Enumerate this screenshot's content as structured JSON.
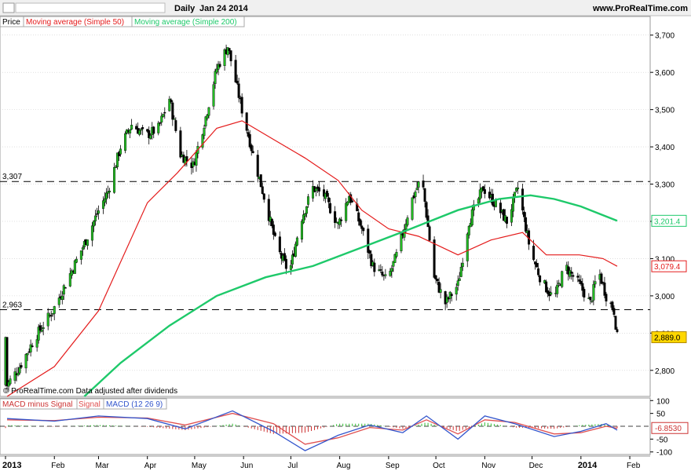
{
  "header": {
    "interval": "Daily",
    "date": "Jan 24 2014",
    "source": "www.ProRealTime.com"
  },
  "legend": {
    "price": "Price",
    "ma50": "Moving average (Simple 50)",
    "ma200": "Moving average (Simple 200)"
  },
  "watermark": "© ProRealTime.com  Data adjusted after dividends",
  "colors": {
    "ma50": "#e41b1b",
    "ma200": "#1ec96a",
    "grid": "#cccccc",
    "last_price_bg": "#ffd700",
    "macd": "#3355cc",
    "signal": "#e05050",
    "hist_pos": "#33bb33",
    "hist_neg": "#cc3333"
  },
  "chart_data": {
    "type": "candlestick",
    "x_axis": {
      "labels": [
        "2013",
        "Feb",
        "Mar",
        "Apr",
        "May",
        "Jun",
        "Jul",
        "Aug",
        "Sep",
        "Oct",
        "Nov",
        "Dec",
        "2014",
        "Feb"
      ],
      "start": "2013-01-01",
      "end": "2014-01-24"
    },
    "y_axis": {
      "ticks": [
        2800,
        2900,
        3000,
        3100,
        3200,
        3300,
        3400,
        3500,
        3600,
        3700
      ],
      "tick_labels": [
        "2,800",
        "2,900",
        "3,000",
        "3,100",
        "3,200",
        "3,300",
        "3,400",
        "3,500",
        "3,600",
        "3,700"
      ],
      "ylim": [
        2730,
        3750
      ]
    },
    "horizontal_lines": [
      {
        "value": 3307,
        "label": "3,307",
        "style": "dashed"
      },
      {
        "value": 2963,
        "label": "2,963",
        "style": "dashed"
      }
    ],
    "last_values": [
      {
        "label": "3,201.4",
        "value": 3201.4,
        "series": "ma200"
      },
      {
        "label": "3,079.4",
        "value": 3079.4,
        "series": "ma50"
      },
      {
        "label": "2,889.0",
        "value": 2889.0,
        "series": "price"
      }
    ],
    "price_path": [
      [
        "2013-01-02",
        2760
      ],
      [
        "2013-01-10",
        2810
      ],
      [
        "2013-01-20",
        2890
      ],
      [
        "2013-01-31",
        2960
      ],
      [
        "2013-02-10",
        3050
      ],
      [
        "2013-02-20",
        3140
      ],
      [
        "2013-02-28",
        3220
      ],
      [
        "2013-03-07",
        3280
      ],
      [
        "2013-03-15",
        3400
      ],
      [
        "2013-03-22",
        3460
      ],
      [
        "2013-03-31",
        3430
      ],
      [
        "2013-04-08",
        3450
      ],
      [
        "2013-04-15",
        3530
      ],
      [
        "2013-04-22",
        3380
      ],
      [
        "2013-04-30",
        3350
      ],
      [
        "2013-05-08",
        3480
      ],
      [
        "2013-05-15",
        3610
      ],
      [
        "2013-05-22",
        3670
      ],
      [
        "2013-05-31",
        3500
      ],
      [
        "2013-06-07",
        3380
      ],
      [
        "2013-06-15",
        3250
      ],
      [
        "2013-06-22",
        3130
      ],
      [
        "2013-06-30",
        3060
      ],
      [
        "2013-07-07",
        3200
      ],
      [
        "2013-07-15",
        3290
      ],
      [
        "2013-07-22",
        3270
      ],
      [
        "2013-07-31",
        3190
      ],
      [
        "2013-08-07",
        3270
      ],
      [
        "2013-08-15",
        3180
      ],
      [
        "2013-08-22",
        3080
      ],
      [
        "2013-08-31",
        3040
      ],
      [
        "2013-09-07",
        3120
      ],
      [
        "2013-09-15",
        3250
      ],
      [
        "2013-09-22",
        3320
      ],
      [
        "2013-09-30",
        3050
      ],
      [
        "2013-10-07",
        2980
      ],
      [
        "2013-10-15",
        3030
      ],
      [
        "2013-10-22",
        3200
      ],
      [
        "2013-10-31",
        3290
      ],
      [
        "2013-11-07",
        3250
      ],
      [
        "2013-11-15",
        3200
      ],
      [
        "2013-11-22",
        3290
      ],
      [
        "2013-11-30",
        3120
      ],
      [
        "2013-12-07",
        3040
      ],
      [
        "2013-12-15",
        2990
      ],
      [
        "2013-12-22",
        3080
      ],
      [
        "2013-12-31",
        3030
      ],
      [
        "2014-01-07",
        2980
      ],
      [
        "2014-01-12",
        3070
      ],
      [
        "2014-01-17",
        3000
      ],
      [
        "2014-01-22",
        2960
      ],
      [
        "2014-01-24",
        2889
      ]
    ],
    "series": [
      {
        "name": "Moving average (Simple 50)",
        "color": "#e41b1b",
        "points": [
          [
            "2013-01-02",
            2730
          ],
          [
            "2013-02-01",
            2810
          ],
          [
            "2013-03-01",
            2960
          ],
          [
            "2013-04-01",
            3250
          ],
          [
            "2013-04-20",
            3330
          ],
          [
            "2013-05-15",
            3450
          ],
          [
            "2013-05-31",
            3470
          ],
          [
            "2013-06-20",
            3420
          ],
          [
            "2013-07-10",
            3370
          ],
          [
            "2013-07-31",
            3310
          ],
          [
            "2013-08-15",
            3230
          ],
          [
            "2013-09-01",
            3180
          ],
          [
            "2013-09-20",
            3160
          ],
          [
            "2013-10-15",
            3110
          ],
          [
            "2013-11-05",
            3150
          ],
          [
            "2013-11-25",
            3170
          ],
          [
            "2013-12-10",
            3110
          ],
          [
            "2013-12-31",
            3110
          ],
          [
            "2014-01-15",
            3100
          ],
          [
            "2014-01-24",
            3079.4
          ]
        ]
      },
      {
        "name": "Moving average (Simple 200)",
        "color": "#1ec96a",
        "points": [
          [
            "2013-02-20",
            2730
          ],
          [
            "2013-03-15",
            2820
          ],
          [
            "2013-04-15",
            2920
          ],
          [
            "2013-05-15",
            3000
          ],
          [
            "2013-06-15",
            3050
          ],
          [
            "2013-07-15",
            3080
          ],
          [
            "2013-08-15",
            3130
          ],
          [
            "2013-09-15",
            3180
          ],
          [
            "2013-10-15",
            3230
          ],
          [
            "2013-11-10",
            3260
          ],
          [
            "2013-11-30",
            3270
          ],
          [
            "2013-12-15",
            3260
          ],
          [
            "2014-01-01",
            3240
          ],
          [
            "2014-01-24",
            3201.4
          ]
        ]
      }
    ],
    "macd_panel": {
      "labels": [
        "MACD minus Signal",
        "Signal",
        "MACD (12 26 9)"
      ],
      "ticks": [
        100,
        50,
        -50,
        -100
      ],
      "tick_labels": [
        "100",
        "50",
        "-50",
        "-100"
      ],
      "ylim": [
        -110,
        110
      ],
      "last_value_label": "-6.8530",
      "last_value": -6.853,
      "macd_path": [
        [
          "2013-01-02",
          30
        ],
        [
          "2013-02-01",
          20
        ],
        [
          "2013-03-01",
          40
        ],
        [
          "2013-04-01",
          30
        ],
        [
          "2013-04-25",
          -10
        ],
        [
          "2013-05-25",
          60
        ],
        [
          "2013-06-20",
          -20
        ],
        [
          "2013-07-10",
          -95
        ],
        [
          "2013-07-31",
          -35
        ],
        [
          "2013-08-20",
          5
        ],
        [
          "2013-09-10",
          -25
        ],
        [
          "2013-09-25",
          40
        ],
        [
          "2013-10-15",
          -50
        ],
        [
          "2013-11-01",
          40
        ],
        [
          "2013-11-20",
          10
        ],
        [
          "2013-12-15",
          -40
        ],
        [
          "2014-01-01",
          -20
        ],
        [
          "2014-01-17",
          10
        ],
        [
          "2014-01-24",
          -15
        ]
      ],
      "signal_path": [
        [
          "2013-01-02",
          25
        ],
        [
          "2013-02-01",
          22
        ],
        [
          "2013-03-01",
          35
        ],
        [
          "2013-04-01",
          32
        ],
        [
          "2013-04-25",
          5
        ],
        [
          "2013-05-25",
          50
        ],
        [
          "2013-06-20",
          10
        ],
        [
          "2013-07-10",
          -70
        ],
        [
          "2013-07-31",
          -45
        ],
        [
          "2013-08-20",
          -5
        ],
        [
          "2013-09-10",
          -15
        ],
        [
          "2013-09-25",
          25
        ],
        [
          "2013-10-15",
          -30
        ],
        [
          "2013-11-01",
          25
        ],
        [
          "2013-11-20",
          15
        ],
        [
          "2013-12-15",
          -30
        ],
        [
          "2014-01-01",
          -25
        ],
        [
          "2014-01-17",
          0
        ],
        [
          "2014-01-24",
          -8
        ]
      ]
    }
  }
}
